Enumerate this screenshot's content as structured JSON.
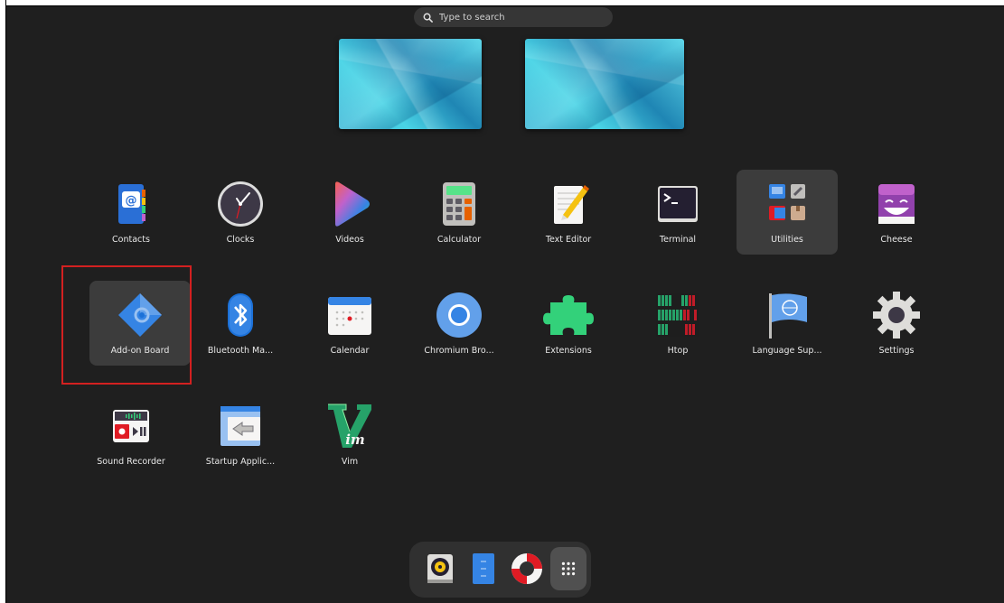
{
  "search": {
    "placeholder": "Type to search"
  },
  "apps": [
    {
      "id": "contacts",
      "label": "Contacts"
    },
    {
      "id": "clocks",
      "label": "Clocks"
    },
    {
      "id": "videos",
      "label": "Videos"
    },
    {
      "id": "calculator",
      "label": "Calculator"
    },
    {
      "id": "text-editor",
      "label": "Text Editor"
    },
    {
      "id": "terminal",
      "label": "Terminal"
    },
    {
      "id": "utilities",
      "label": "Utilities"
    },
    {
      "id": "cheese",
      "label": "Cheese"
    },
    {
      "id": "add-on-board",
      "label": "Add-on Board"
    },
    {
      "id": "bluetooth",
      "label": "Bluetooth Ma..."
    },
    {
      "id": "calendar",
      "label": "Calendar"
    },
    {
      "id": "chromium",
      "label": "Chromium Bro..."
    },
    {
      "id": "extensions",
      "label": "Extensions"
    },
    {
      "id": "htop",
      "label": "Htop"
    },
    {
      "id": "language-support",
      "label": "Language Sup..."
    },
    {
      "id": "settings",
      "label": "Settings"
    },
    {
      "id": "sound-recorder",
      "label": "Sound Recorder"
    },
    {
      "id": "startup-applications",
      "label": "Startup Applic..."
    },
    {
      "id": "vim",
      "label": "Vim"
    }
  ],
  "dock": {
    "items": [
      {
        "icon": "rhythmbox-icon"
      },
      {
        "icon": "files-icon"
      },
      {
        "icon": "help-lifebuoy-icon"
      },
      {
        "icon": "show-apps-grid-icon"
      }
    ]
  },
  "colors": {
    "background": "#1f1f1f",
    "highlight": "#3c3c3c",
    "selection_border": "#d32020",
    "accent_blue": "#3584e4"
  }
}
